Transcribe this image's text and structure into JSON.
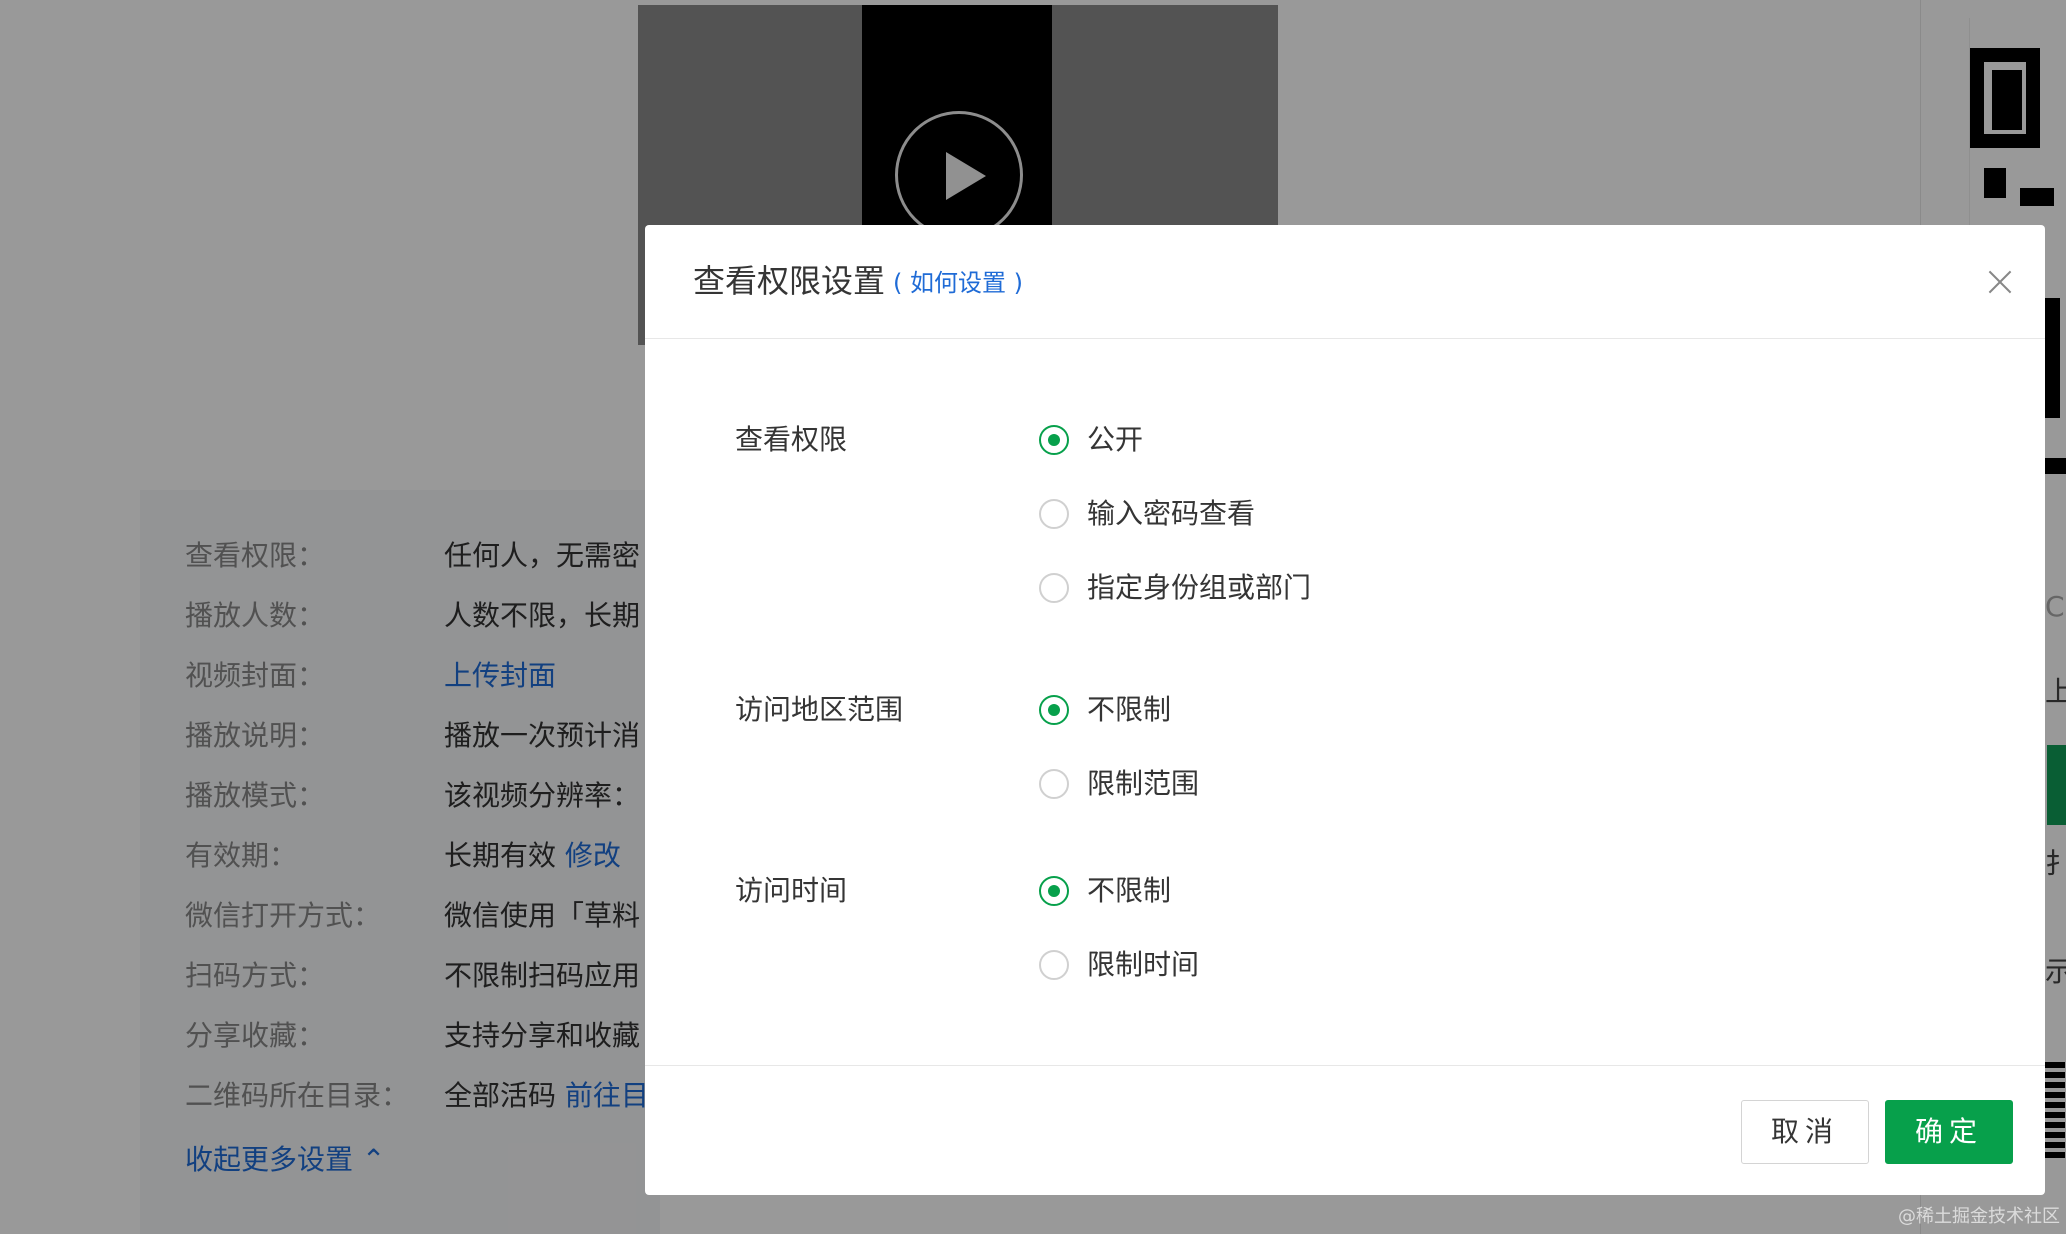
{
  "background": {
    "settings": [
      {
        "label": "查看权限：",
        "value": "任何人，无需密"
      },
      {
        "label": "播放人数：",
        "value": "人数不限，长期"
      },
      {
        "label": "视频封面：",
        "value": "",
        "link": "上传封面"
      },
      {
        "label": "播放说明：",
        "value": "播放一次预计消"
      },
      {
        "label": "播放模式：",
        "value": "该视频分辨率："
      },
      {
        "label": "有效期：",
        "value": "长期有效",
        "link": "修改"
      },
      {
        "label": "微信打开方式：",
        "value": "微信使用「草料"
      },
      {
        "label": "扫码方式：",
        "value": "不限制扫码应用"
      },
      {
        "label": "分享收藏：",
        "value": "支持分享和收藏"
      },
      {
        "label": "二维码所在目录：",
        "value": "全部活码",
        "link": "前往目"
      }
    ],
    "collapse_link": "收起更多设置 ⌃",
    "side": {
      "text1": "C",
      "text2": "上",
      "text3": "扌",
      "text4": "示"
    }
  },
  "modal": {
    "title": "查看权限设置",
    "help_link": "( 如何设置 )",
    "sections": [
      {
        "label": "查看权限",
        "options": [
          {
            "label": "公开",
            "checked": true
          },
          {
            "label": "输入密码查看",
            "checked": false
          },
          {
            "label": "指定身份组或部门",
            "checked": false
          }
        ]
      },
      {
        "label": "访问地区范围",
        "options": [
          {
            "label": "不限制",
            "checked": true
          },
          {
            "label": "限制范围",
            "checked": false
          }
        ]
      },
      {
        "label": "访问时间",
        "options": [
          {
            "label": "不限制",
            "checked": true
          },
          {
            "label": "限制时间",
            "checked": false
          }
        ]
      }
    ],
    "cancel_label": "取消",
    "ok_label": "确定"
  },
  "watermark": "@稀土掘金技术社区",
  "colors": {
    "accent": "#07a04b",
    "link": "#1f6bd6"
  }
}
